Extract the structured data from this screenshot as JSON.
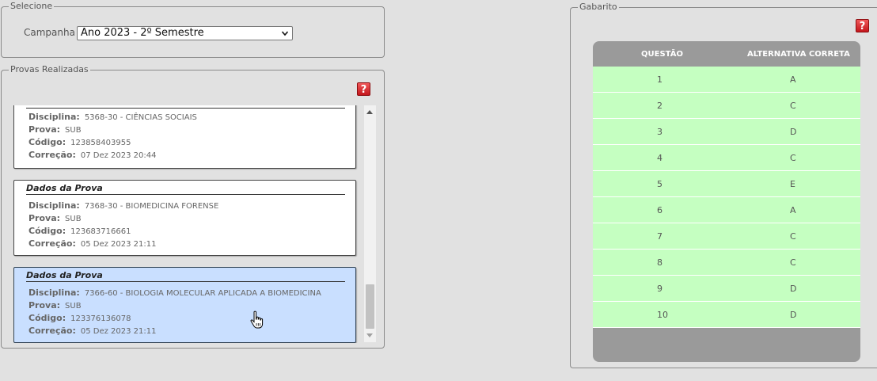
{
  "selecione": {
    "legend": "Selecione",
    "campanha_label": "Campanha",
    "campanha_value": "Ano 2023 - 2º Semestre"
  },
  "provas": {
    "legend": "Provas Realizadas",
    "help_label": "?",
    "cards": [
      {
        "title": "",
        "disciplina_label": "Disciplina:",
        "disciplina": "5368-30 - CIÊNCIAS SOCIAIS",
        "prova_label": "Prova:",
        "prova": "SUB",
        "codigo_label": "Código:",
        "codigo": "123858403955",
        "correcao_label": "Correção:",
        "correcao": "07 Dez 2023 20:44"
      },
      {
        "title": "Dados da Prova",
        "disciplina_label": "Disciplina:",
        "disciplina": "7368-30 - BIOMEDICINA FORENSE",
        "prova_label": "Prova:",
        "prova": "SUB",
        "codigo_label": "Código:",
        "codigo": "123683716661",
        "correcao_label": "Correção:",
        "correcao": "05 Dez 2023 21:11"
      },
      {
        "title": "Dados da Prova",
        "disciplina_label": "Disciplina:",
        "disciplina": "7366-60 - BIOLOGIA MOLECULAR APLICADA A BIOMEDICINA",
        "prova_label": "Prova:",
        "prova": "SUB",
        "codigo_label": "Código:",
        "codigo": "123376136078",
        "correcao_label": "Correção:",
        "correcao": "05 Dez 2023 21:11"
      }
    ]
  },
  "gabarito": {
    "legend": "Gabarito",
    "help_label": "?",
    "col_questao": "QUESTÃO",
    "col_alternativa": "ALTERNATIVA CORRETA",
    "rows": [
      {
        "q": "1",
        "a": "A"
      },
      {
        "q": "2",
        "a": "C"
      },
      {
        "q": "3",
        "a": "D"
      },
      {
        "q": "4",
        "a": "C"
      },
      {
        "q": "5",
        "a": "E"
      },
      {
        "q": "6",
        "a": "A"
      },
      {
        "q": "7",
        "a": "C"
      },
      {
        "q": "8",
        "a": "C"
      },
      {
        "q": "9",
        "a": "D"
      },
      {
        "q": "10",
        "a": "D"
      }
    ]
  },
  "colors": {
    "background": "#e1e1e1",
    "selected_card": "#c9dfff",
    "gabarito_row": "#c5ffc1",
    "gabarito_header": "#9a9a9a",
    "help_button": "#d7262b"
  }
}
